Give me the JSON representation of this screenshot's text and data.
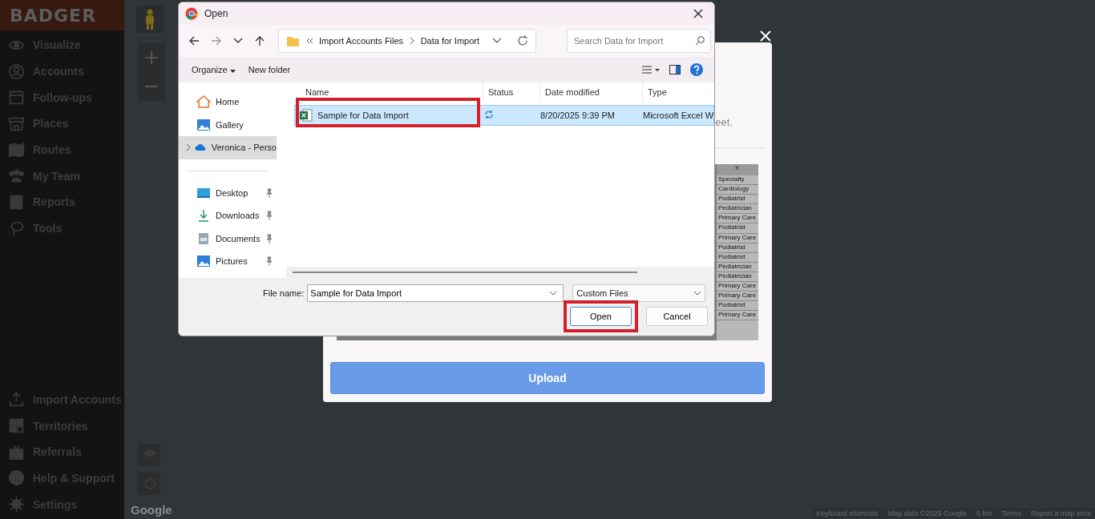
{
  "sidebar": {
    "brand": "BADGER",
    "items": [
      {
        "label": "Visualize"
      },
      {
        "label": "Accounts"
      },
      {
        "label": "Follow-ups"
      },
      {
        "label": "Places"
      },
      {
        "label": "Routes"
      },
      {
        "label": "My Team"
      },
      {
        "label": "Reports"
      },
      {
        "label": "Tools"
      }
    ],
    "bottom_items": [
      {
        "label": "Import Accounts"
      },
      {
        "label": "Territories"
      },
      {
        "label": "Referrals"
      },
      {
        "label": "Help & Support"
      },
      {
        "label": "Settings"
      }
    ]
  },
  "map": {
    "logo": "Google",
    "attribution": [
      "Keyboard shortcuts",
      "Map data ©2025 Google",
      "5 km",
      "Terms",
      "Report a map error"
    ]
  },
  "upload_modal": {
    "partial_text": "eet.",
    "preview": {
      "column": "K",
      "cells": [
        "Specialty",
        "Cardiology",
        "Podiatrist",
        "Pediatrician",
        "Primary Care",
        "Podiatrist",
        "Primary Care",
        "Podiatrist",
        "Podiatrist",
        "Pediatrician",
        "Pediatrician",
        "Primary Care",
        "Primary Care",
        "Podiatrist",
        "Primary Care"
      ]
    },
    "button": "Upload"
  },
  "file_dialog": {
    "title": "Open",
    "breadcrumb": [
      "Import Accounts Files",
      "Data for Import"
    ],
    "search": {
      "placeholder": "Search Data for Import"
    },
    "toolbar": [
      "Organize",
      "New folder"
    ],
    "nav": [
      {
        "label": "Home",
        "selected": false,
        "pinned": false
      },
      {
        "label": "Gallery",
        "selected": false,
        "pinned": false
      },
      {
        "label": "Veronica - Perso",
        "selected": true,
        "pinned": false,
        "expanded": false
      },
      {
        "label": "Desktop",
        "selected": false,
        "pinned": true
      },
      {
        "label": "Downloads",
        "selected": false,
        "pinned": true
      },
      {
        "label": "Documents",
        "selected": false,
        "pinned": true
      },
      {
        "label": "Pictures",
        "selected": false,
        "pinned": true
      }
    ],
    "columns": [
      "Name",
      "Status",
      "Date modified",
      "Type"
    ],
    "files": [
      {
        "name": "Sample for Data Import",
        "date": "8/20/2025 9:39 PM",
        "type": "Microsoft Excel W",
        "selected": true,
        "highlighted": true
      }
    ],
    "file_name": {
      "label": "File name:",
      "value": "Sample for Data Import"
    },
    "filter": "Custom Files",
    "buttons": [
      {
        "label": "Open",
        "highlighted": true
      },
      {
        "label": "Cancel",
        "highlighted": false
      }
    ]
  }
}
